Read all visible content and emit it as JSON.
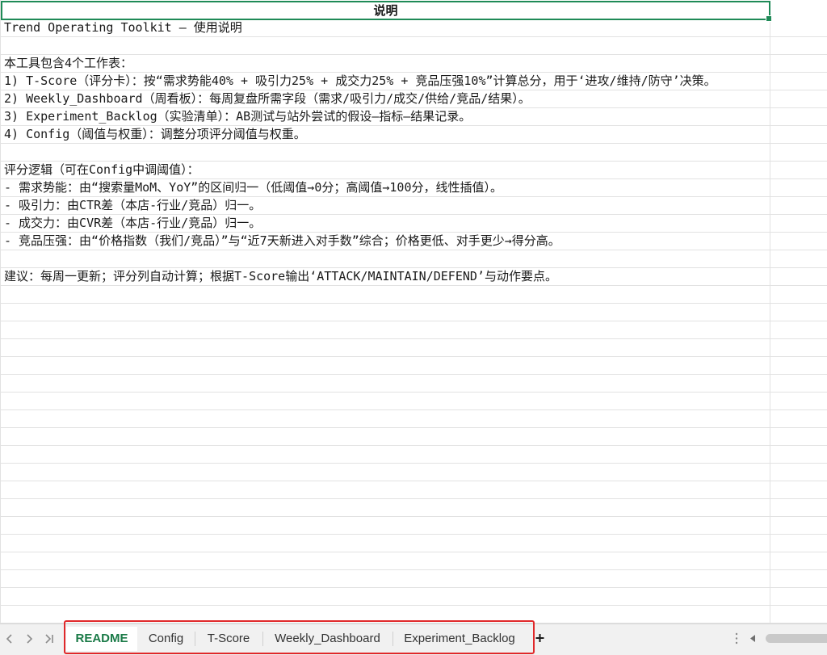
{
  "sheet": {
    "title_cell": "说明",
    "rows": [
      "Trend Operating Toolkit — 使用说明",
      "",
      "本工具包含4个工作表：",
      "1) T-Score（评分卡）：按“需求势能40% + 吸引力25% + 成交力25% + 竞品压强10%”计算总分，用于‘进攻/维持/防守’决策。",
      "2) Weekly_Dashboard（周看板）：每周复盘所需字段（需求/吸引力/成交/供给/竞品/结果）。",
      "3) Experiment_Backlog（实验清单）：AB测试与站外尝试的假设—指标—结果记录。",
      "4) Config（阈值与权重）：调整分项评分阈值与权重。",
      "",
      "评分逻辑（可在Config中调阈值）：",
      "- 需求势能：由“搜索量MoM、YoY”的区间归一（低阈值→0分；高阈值→100分，线性插值）。",
      "- 吸引力：由CTR差（本店-行业/竞品）归一。",
      "- 成交力：由CVR差（本店-行业/竞品）归一。",
      "- 竞品压强：由“价格指数（我们/竞品）”与“近7天新进入对手数”综合；价格更低、对手更少→得分高。",
      "",
      "建议：每周一更新；评分列自动计算；根据T-Score输出‘ATTACK/MAINTAIN/DEFEND’与动作要点。"
    ]
  },
  "tab_bar": {
    "nav_icons": [
      "chevron-left-icon",
      "chevron-right-icon",
      "last-sheet-icon"
    ],
    "tabs": [
      {
        "label": "README",
        "active": true
      },
      {
        "label": "Config",
        "active": false
      },
      {
        "label": "T-Score",
        "active": false
      },
      {
        "label": "Weekly_Dashboard",
        "active": false
      },
      {
        "label": "Experiment_Backlog",
        "active": false
      }
    ],
    "add_icon": "plus-icon",
    "scroll_icons": [
      "split-handle-icon",
      "scroll-left-icon"
    ]
  },
  "colors": {
    "selection_border": "#1f8a57",
    "active_tab_text": "#1a7a47",
    "annotation_box": "#e0282a",
    "gridline": "#e2e2e2"
  }
}
